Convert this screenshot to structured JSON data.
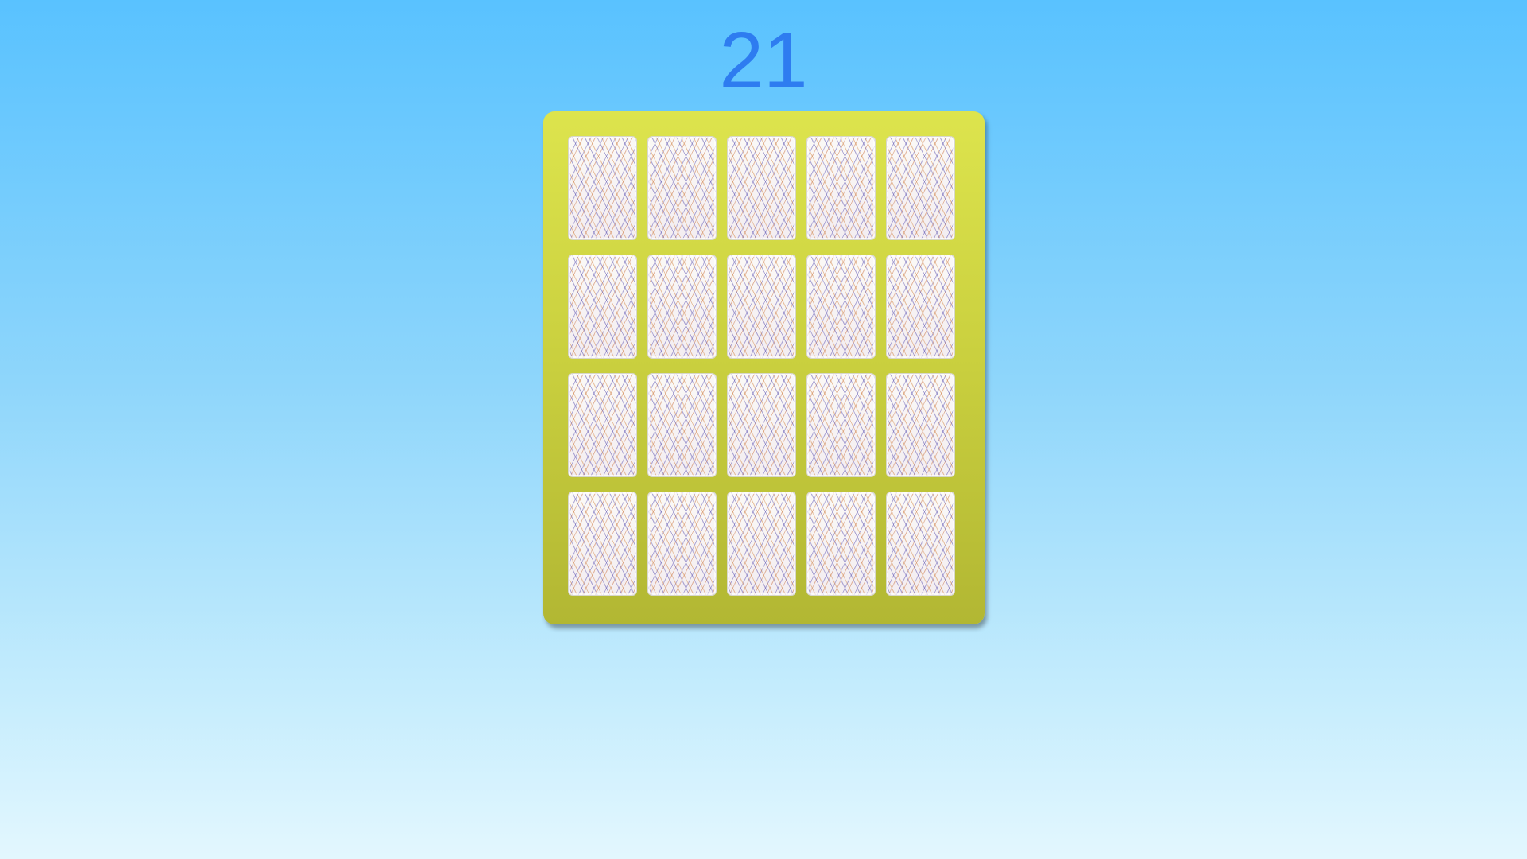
{
  "counter": {
    "value": "21"
  },
  "board": {
    "rows": 4,
    "columns": 5,
    "cards": [
      {
        "state": "face-down"
      },
      {
        "state": "face-down"
      },
      {
        "state": "face-down"
      },
      {
        "state": "face-down"
      },
      {
        "state": "face-down"
      },
      {
        "state": "face-down"
      },
      {
        "state": "face-down"
      },
      {
        "state": "face-down"
      },
      {
        "state": "face-down"
      },
      {
        "state": "face-down"
      },
      {
        "state": "face-down"
      },
      {
        "state": "face-down"
      },
      {
        "state": "face-down"
      },
      {
        "state": "face-down"
      },
      {
        "state": "face-down"
      },
      {
        "state": "face-down"
      },
      {
        "state": "face-down"
      },
      {
        "state": "face-down"
      },
      {
        "state": "face-down"
      },
      {
        "state": "face-down"
      }
    ]
  },
  "colors": {
    "counter_text": "#2e7cf0",
    "board": "#c9cf3e",
    "background_top": "#59c2ff",
    "background_bottom": "#e3f7fe"
  }
}
